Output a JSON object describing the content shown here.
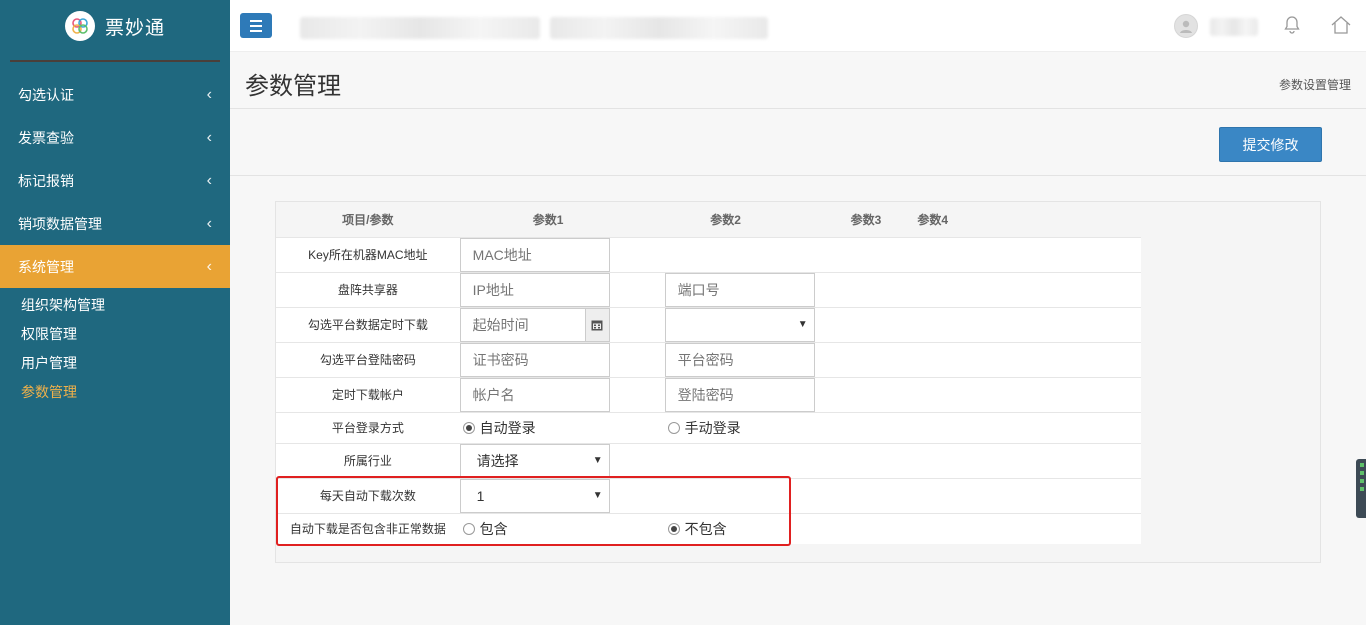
{
  "brand": {
    "name": "票妙通",
    "logo_icon": "clover-logo-icon"
  },
  "sidebar": {
    "items": [
      {
        "label": "勾选认证",
        "active": false
      },
      {
        "label": "发票查验",
        "active": false
      },
      {
        "label": "标记报销",
        "active": false
      },
      {
        "label": "销项数据管理",
        "active": false
      },
      {
        "label": "系统管理",
        "active": true
      }
    ],
    "submenu": [
      {
        "label": "组织架构管理",
        "current": false
      },
      {
        "label": "权限管理",
        "current": false
      },
      {
        "label": "用户管理",
        "current": false
      },
      {
        "label": "参数管理",
        "current": true
      }
    ],
    "chevron": "‹"
  },
  "topbar": {
    "menu_icon": "hamburger-icon",
    "bell_icon": "bell-icon",
    "home_icon": "home-icon"
  },
  "page": {
    "title": "参数管理",
    "breadcrumb": "参数设置管理"
  },
  "actions": {
    "submit_label": "提交修改"
  },
  "table": {
    "headers": [
      "项目/参数",
      "参数1",
      "参数2",
      "参数3",
      "参数4"
    ],
    "rows": {
      "mac": {
        "label": "Key所在机器MAC地址",
        "p1_placeholder": "MAC地址"
      },
      "disk": {
        "label": "盘阵共享器",
        "p1_placeholder": "IP地址",
        "p2_placeholder": "端口号"
      },
      "schedule": {
        "label": "勾选平台数据定时下载",
        "p1_placeholder": "起始时间",
        "p2_value": ""
      },
      "login_pwd": {
        "label": "勾选平台登陆密码",
        "p1_placeholder": "证书密码",
        "p2_placeholder": "平台密码"
      },
      "account": {
        "label": "定时下载帐户",
        "p1_placeholder": "帐户名",
        "p2_placeholder": "登陆密码"
      },
      "login_mode": {
        "label": "平台登录方式",
        "opt1": "自动登录",
        "opt2": "手动登录",
        "selected": "自动登录"
      },
      "industry": {
        "label": "所属行业",
        "value": "请选择"
      },
      "daily_count": {
        "label": "每天自动下载次数",
        "value": "1"
      },
      "abnormal": {
        "label": "自动下载是否包含非正常数据",
        "opt1": "包含",
        "opt2": "不包含",
        "selected": "不包含"
      }
    }
  },
  "colors": {
    "sidebar": "#1f687f",
    "active": "#e9a334",
    "primary": "#3a87c5",
    "highlight": "#e02020"
  }
}
